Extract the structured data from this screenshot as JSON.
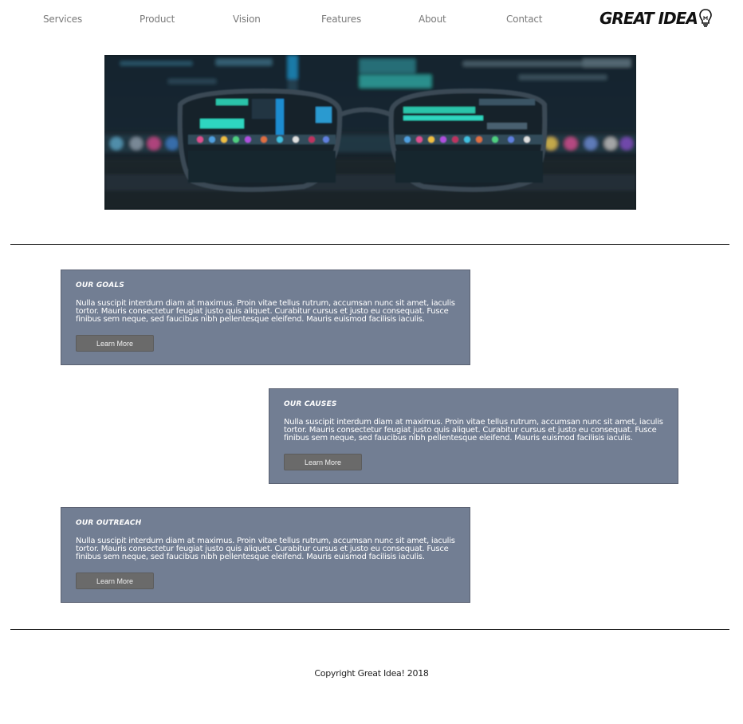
{
  "nav": {
    "items": [
      {
        "label": "Services"
      },
      {
        "label": "Product"
      },
      {
        "label": "Vision"
      },
      {
        "label": "Features"
      },
      {
        "label": "About"
      },
      {
        "label": "Contact"
      }
    ],
    "logo_text": "GREAT IDEA"
  },
  "hero": {
    "icon": "eyeglasses-on-keyboard-photo"
  },
  "cards": [
    {
      "title": "OUR GOALS",
      "body": "Nulla suscipit interdum diam at maximus. Proin vitae tellus rutrum, accumsan nunc sit amet, iaculis tortor. Mauris consectetur feugiat justo quis aliquet. Curabitur cursus et justo eu consequat. Fusce finibus sem neque, sed faucibus nibh pellentesque eleifend. Mauris euismod facilisis iaculis.",
      "button": "Learn More"
    },
    {
      "title": "OUR CAUSES",
      "body": "Nulla suscipit interdum diam at maximus. Proin vitae tellus rutrum, accumsan nunc sit amet, iaculis tortor. Mauris consectetur feugiat justo quis aliquet. Curabitur cursus et justo eu consequat. Fusce finibus sem neque, sed faucibus nibh pellentesque eleifend. Mauris euismod facilisis iaculis.",
      "button": "Learn More"
    },
    {
      "title": "OUR OUTREACH",
      "body": "Nulla suscipit interdum diam at maximus. Proin vitae tellus rutrum, accumsan nunc sit amet, iaculis tortor. Mauris consectetur feugiat justo quis aliquet. Curabitur cursus et justo eu consequat. Fusce finibus sem neque, sed faucibus nibh pellentesque eleifend. Mauris euismod facilisis iaculis.",
      "button": "Learn More"
    }
  ],
  "footer": {
    "copyright": "Copyright Great Idea! 2018"
  },
  "colors": {
    "card_bg": "#727e93",
    "button_bg": "#6a6a6a",
    "nav_text": "#7a7a7a"
  }
}
